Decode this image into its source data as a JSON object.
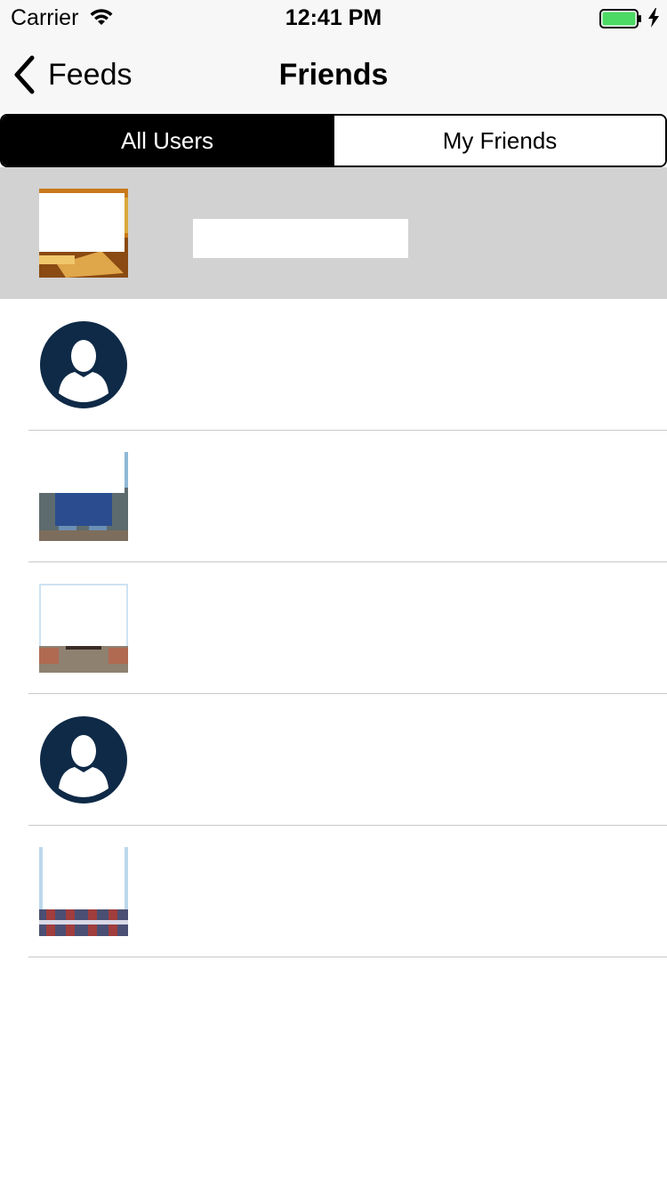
{
  "status_bar": {
    "carrier": "Carrier",
    "time": "12:41 PM",
    "wifi_icon": "wifi-icon",
    "battery_icon": "battery-full-icon",
    "battery_color": "#4cd964",
    "charging_icon": "bolt-icon"
  },
  "nav": {
    "back_label": "Feeds",
    "back_icon": "chevron-left-icon",
    "title": "Friends"
  },
  "segments": {
    "all_users": "All Users",
    "my_friends": "My Friends",
    "selected": "All Users"
  },
  "users": [
    {
      "avatar": "photo",
      "name": "",
      "selected": true
    },
    {
      "avatar": "default-person-icon",
      "name": ""
    },
    {
      "avatar": "photo",
      "name": ""
    },
    {
      "avatar": "photo",
      "name": ""
    },
    {
      "avatar": "default-person-icon",
      "name": ""
    },
    {
      "avatar": "photo",
      "name": ""
    }
  ],
  "colors": {
    "avatar_default_bg": "#0f2a47",
    "selected_row_bg": "#d2d2d2",
    "separator": "#c8c7cc"
  }
}
